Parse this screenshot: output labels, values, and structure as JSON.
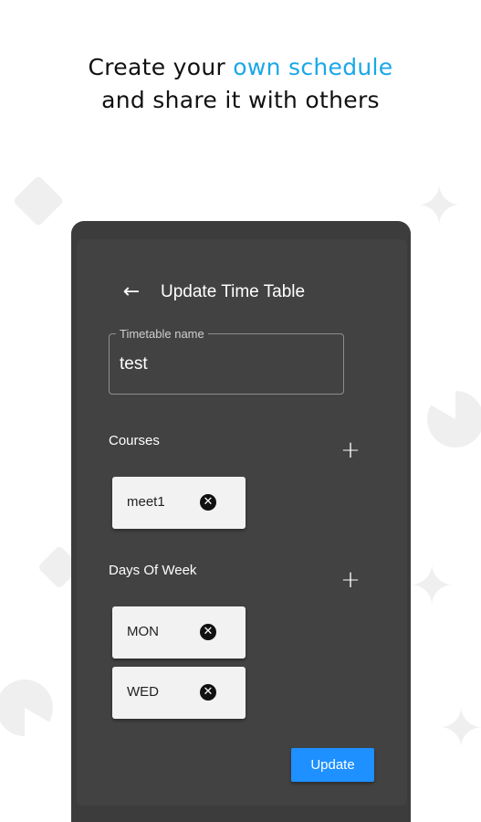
{
  "promo": {
    "line1_start": "Create your ",
    "line1_accent": "own schedule",
    "line2": "and share it with others",
    "accent_color": "#1aa7e8"
  },
  "appbar": {
    "back_icon": "arrow-left-icon",
    "title": "Update Time Table"
  },
  "timetable_field": {
    "label": "Timetable name",
    "value": "test"
  },
  "courses": {
    "label": "Courses",
    "add_icon": "plus-icon",
    "items": [
      {
        "label": "meet1",
        "remove_icon": "close-circle-icon"
      }
    ]
  },
  "days": {
    "label": "Days Of Week",
    "add_icon": "plus-icon",
    "items": [
      {
        "label": "MON",
        "remove_icon": "close-circle-icon"
      },
      {
        "label": "WED",
        "remove_icon": "close-circle-icon"
      }
    ]
  },
  "actions": {
    "update_label": "Update",
    "button_color": "#1e90ff"
  },
  "theme": {
    "surface": "#424242",
    "device": "#3c3c3c",
    "chip": "#f2f2f2"
  }
}
